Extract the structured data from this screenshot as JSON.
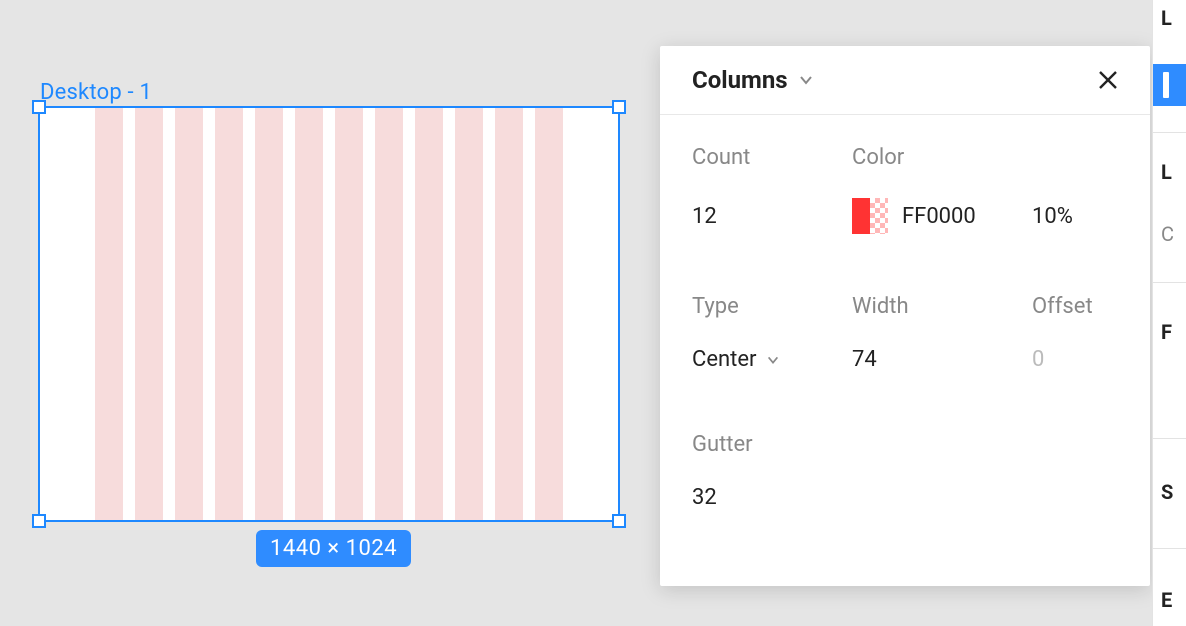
{
  "canvas": {
    "frame_label": "Desktop - 1",
    "size_label": "1440 × 1024"
  },
  "panel": {
    "title": "Columns",
    "labels": {
      "count": "Count",
      "color": "Color",
      "type": "Type",
      "width": "Width",
      "offset": "Offset",
      "gutter": "Gutter"
    },
    "values": {
      "count": "12",
      "color_hex": "FF0000",
      "color_opacity": "10%",
      "type": "Center",
      "width": "74",
      "offset_placeholder": "0",
      "gutter": "32"
    },
    "color_swatch": "#ff0000"
  },
  "right_sidebar": {
    "items": [
      "L",
      "L",
      "C",
      "F",
      "S",
      "E"
    ]
  }
}
